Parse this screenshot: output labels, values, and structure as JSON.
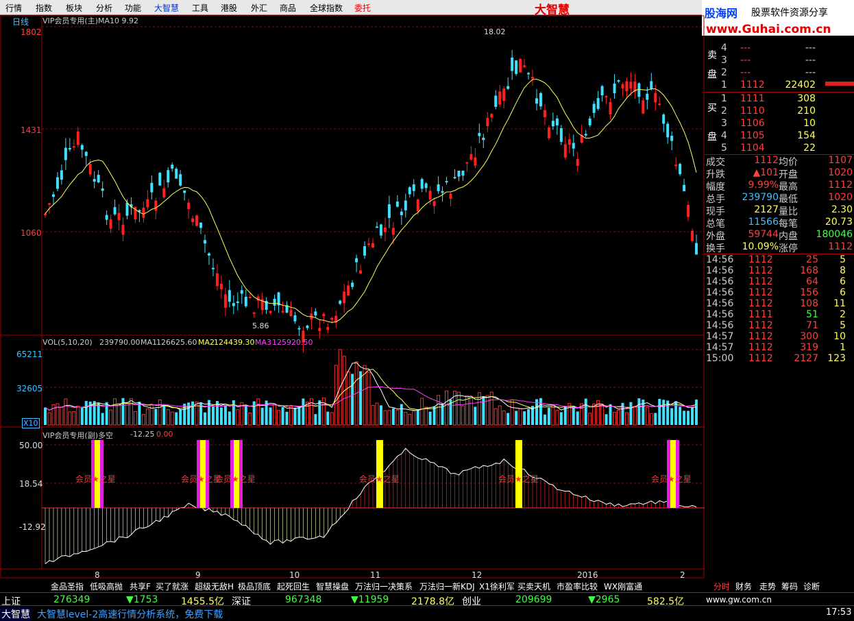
{
  "menu": [
    "行情",
    "指数",
    "板块",
    "分析",
    "功能",
    "大智慧",
    "工具",
    "港股",
    "外汇",
    "商品",
    "全球指数",
    "委托"
  ],
  "brand": "大智慧",
  "logo": {
    "name": "股海网",
    "slogan": "股票软件资源分享",
    "url": "www.Guhai.com.cn"
  },
  "main_chart": {
    "period": "日线",
    "title": "VIP会员专用(主)MA10 9.92",
    "price_labels": [
      "1802",
      "1431",
      "1060"
    ],
    "high_mark": "18.02",
    "low_mark": "5.86",
    "ma_title": "MA10"
  },
  "volume_chart": {
    "title": "VOL(5,10,20)",
    "vol": "239790.00",
    "ma1_label": "MA1",
    "ma1": "126625.60",
    "ma2_label": "MA2",
    "ma2": "124439.30",
    "ma3_label": "MA3",
    "ma3": "125920.50",
    "labels": [
      "65211",
      "32605"
    ],
    "unit": "X10"
  },
  "indicator_chart": {
    "title": "VIP会员专用(副)多空",
    "value1": "-12.25",
    "value2": "0.00",
    "labels": [
      "50.00",
      "18.54",
      "-12.92"
    ],
    "signal_text": "会员★之星"
  },
  "x_axis": [
    "8",
    "9",
    "10",
    "11",
    "12",
    "2016",
    "2"
  ],
  "orderbook": {
    "sell_label": [
      "卖",
      "盘"
    ],
    "buy_label": [
      "买",
      "盘"
    ],
    "sells": [
      {
        "lvl": "4",
        "price": "---",
        "vol": "---"
      },
      {
        "lvl": "3",
        "price": "---",
        "vol": "---"
      },
      {
        "lvl": "2",
        "price": "---",
        "vol": "---"
      },
      {
        "lvl": "1",
        "price": "1112",
        "vol": "22402"
      }
    ],
    "buys": [
      {
        "lvl": "1",
        "price": "1111",
        "vol": "308"
      },
      {
        "lvl": "2",
        "price": "1110",
        "vol": "210"
      },
      {
        "lvl": "3",
        "price": "1106",
        "vol": "10"
      },
      {
        "lvl": "4",
        "price": "1105",
        "vol": "154"
      },
      {
        "lvl": "5",
        "price": "1104",
        "vol": "22"
      }
    ]
  },
  "stats": [
    {
      "k1": "成交",
      "v1": "1112",
      "k2": "均价",
      "v2": "1107"
    },
    {
      "k1": "升跌",
      "v1": "▲101",
      "k2": "开盘",
      "v2": "1020"
    },
    {
      "k1": "幅度",
      "v1": "9.99%",
      "k2": "最高",
      "v2": "1112"
    },
    {
      "k1": "总手",
      "v1": "239790",
      "k2": "最低",
      "v2": "1020"
    },
    {
      "k1": "现手",
      "v1": "2127",
      "k2": "量比",
      "v2": "2.30"
    },
    {
      "k1": "总笔",
      "v1": "11566",
      "k2": "每笔",
      "v2": "20.73"
    },
    {
      "k1": "外盘",
      "v1": "59744",
      "k2": "内盘",
      "v2": "180046"
    },
    {
      "k1": "换手",
      "v1": "10.09%",
      "k2": "涨停",
      "v2": "1112"
    }
  ],
  "ticks": [
    {
      "t": "14:56",
      "p": "1112",
      "v": "25",
      "n": "5"
    },
    {
      "t": "14:56",
      "p": "1112",
      "v": "168",
      "n": "8"
    },
    {
      "t": "14:56",
      "p": "1112",
      "v": "64",
      "n": "6"
    },
    {
      "t": "14:56",
      "p": "1112",
      "v": "156",
      "n": "6"
    },
    {
      "t": "14:56",
      "p": "1112",
      "v": "108",
      "n": "11"
    },
    {
      "t": "14:56",
      "p": "1111",
      "v": "51",
      "n": "2"
    },
    {
      "t": "14:56",
      "p": "1112",
      "v": "71",
      "n": "5"
    },
    {
      "t": "14:57",
      "p": "1112",
      "v": "300",
      "n": "10"
    },
    {
      "t": "14:57",
      "p": "1112",
      "v": "319",
      "n": "1"
    },
    {
      "t": "15:00",
      "p": "1112",
      "v": "2127",
      "n": "123"
    }
  ],
  "bottom_tabs": [
    "金品圣指",
    "低吸高抛",
    "共享F",
    "买了就涨",
    "超级无敌H",
    "极品顶底",
    "起死回生",
    "智慧操盘",
    "万法归一决策系",
    "万法归一新KDJ",
    "X1徐利军",
    "买卖天机",
    "市盈率比较",
    "WX刚富通"
  ],
  "right_tabs": [
    "分时",
    "财务",
    "走势",
    "筹码",
    "诊断"
  ],
  "status": {
    "sh_label": "上证",
    "sh_val": "276349",
    "sh_chg": "▼1753",
    "sh_amt": "1455.5亿",
    "sz_label": "深证",
    "sz_val": "967348",
    "sz_chg": "▼11959",
    "sz_amt": "2178.8亿",
    "cy_label": "创业",
    "cy_val": "209699",
    "cy_chg": "▼2965",
    "cy_amt": "582.5亿",
    "site": "www.gw.com.cn",
    "app": "大智慧",
    "ad": "大智慧level-2高速行情分析系统，免费下载",
    "time": "17:53"
  }
}
